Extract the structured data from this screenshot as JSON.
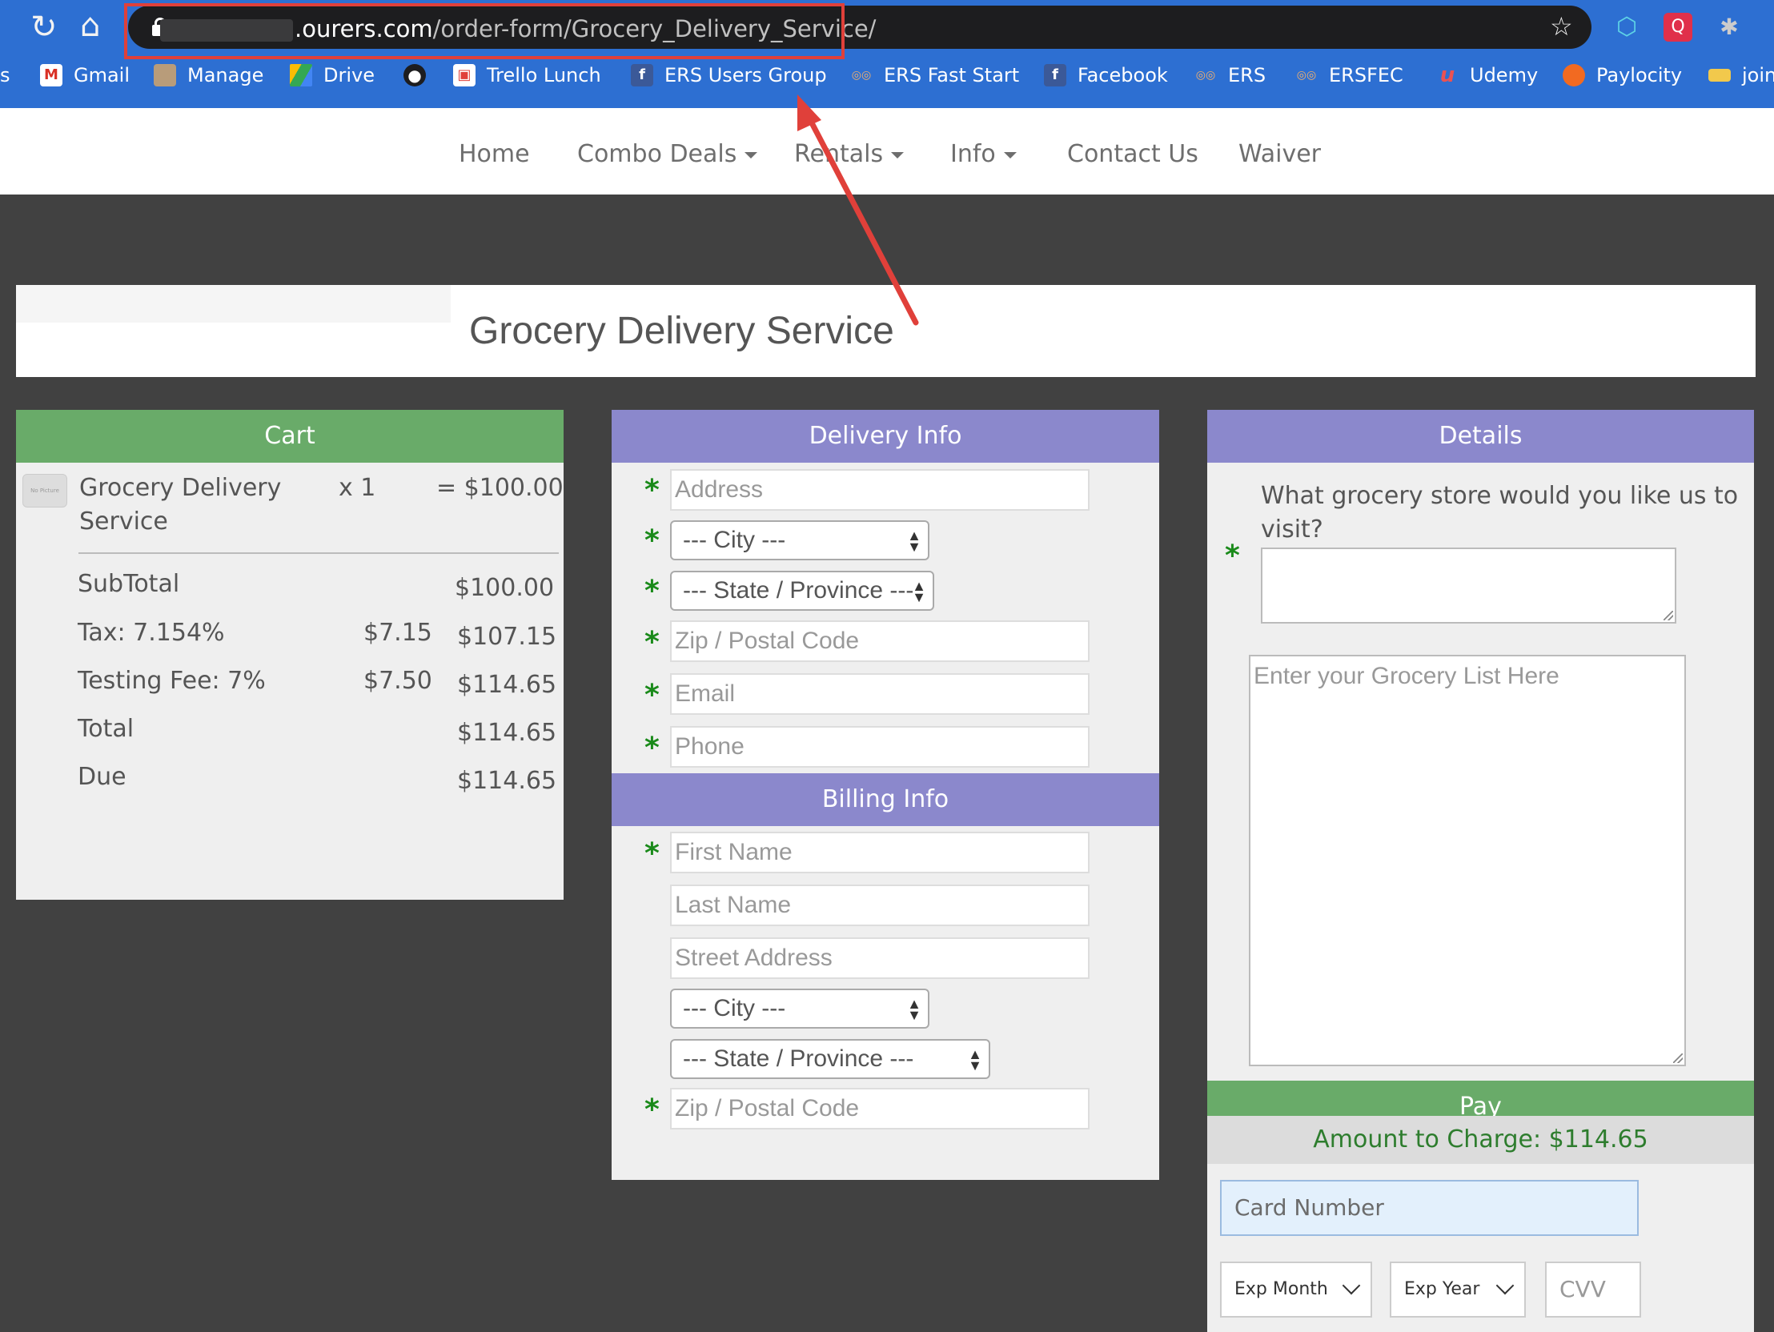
{
  "browser": {
    "url_host": ".ourers.com",
    "url_path": "/order-form/Grocery_Delivery_Service/",
    "bookmarks": [
      {
        "label": "s",
        "icon": ""
      },
      {
        "label": "Gmail",
        "icon": "gmail-icon"
      },
      {
        "label": "Manage",
        "icon": "manage-icon"
      },
      {
        "label": "Drive",
        "icon": "drive-icon"
      },
      {
        "label": "",
        "icon": "globe-icon"
      },
      {
        "label": "Trello Lunch",
        "icon": "trello-icon"
      },
      {
        "label": "ERS Users Group",
        "icon": "facebook-icon"
      },
      {
        "label": "ERS Fast Start",
        "icon": "ers-icon"
      },
      {
        "label": "Facebook",
        "icon": "facebook-icon"
      },
      {
        "label": "ERS",
        "icon": "ers-icon"
      },
      {
        "label": "ERSFEC",
        "icon": "ers-icon"
      },
      {
        "label": "Udemy",
        "icon": "udemy-icon"
      },
      {
        "label": "Paylocity",
        "icon": "paylocity-icon"
      },
      {
        "label": "join",
        "icon": "join-icon"
      }
    ]
  },
  "nav": {
    "items": [
      {
        "label": "Home",
        "dropdown": false
      },
      {
        "label": "Combo Deals",
        "dropdown": true
      },
      {
        "label": "Rentals",
        "dropdown": true
      },
      {
        "label": "Info",
        "dropdown": true
      },
      {
        "label": "Contact Us",
        "dropdown": false
      },
      {
        "label": "Waiver",
        "dropdown": false
      }
    ]
  },
  "page": {
    "title": "Grocery Delivery Service"
  },
  "cart": {
    "header": "Cart",
    "thumb_text": "No Picture",
    "item": {
      "name_line1": "Grocery Delivery",
      "name_line2": "Service",
      "qty": "x  1",
      "price": "= $100.00"
    },
    "rows": [
      {
        "label": "SubTotal",
        "amount": "",
        "total": "$100.00"
      },
      {
        "label": "Tax: 7.154%",
        "amount": "$7.15",
        "total": "$107.15"
      },
      {
        "label": "Testing Fee: 7%",
        "amount": "$7.50",
        "total": "$114.65"
      },
      {
        "label": "Total",
        "amount": "",
        "total": "$114.65"
      },
      {
        "label": "Due",
        "amount": "",
        "total": "$114.65"
      }
    ]
  },
  "delivery": {
    "header": "Delivery Info",
    "address_ph": "Address",
    "city": "--- City ---",
    "state": "--- State / Province ---",
    "zip_ph": "Zip / Postal Code",
    "email_ph": "Email",
    "phone_ph": "Phone"
  },
  "billing": {
    "header": "Billing Info",
    "first_ph": "First Name",
    "last_ph": "Last Name",
    "street_ph": "Street Address",
    "city": "--- City ---",
    "state": "--- State / Province ---",
    "zip_ph": "Zip / Postal Code"
  },
  "details": {
    "header": "Details",
    "question_line1": "What grocery store would you like us to",
    "question_line2": "visit?",
    "list_ph": "Enter your Grocery List Here"
  },
  "pay": {
    "header": "Pay",
    "amount": "Amount to Charge: $114.65",
    "card_ph": "Card Number",
    "exp_month": "Exp Month",
    "exp_year": "Exp Year",
    "cvv_ph": "CVV"
  },
  "colors": {
    "green": "#69ab69",
    "purple": "#8b88cc",
    "required": "#1a8a1a",
    "annotation": "#e0403a"
  }
}
